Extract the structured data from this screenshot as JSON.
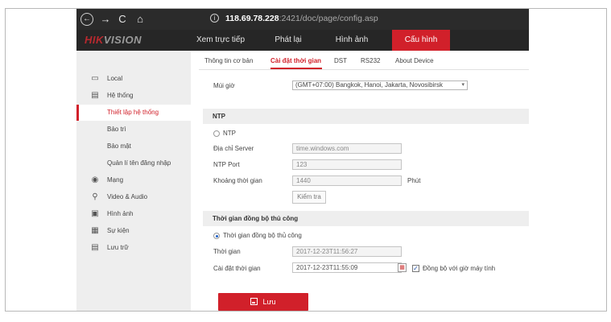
{
  "browser": {
    "back": "←",
    "forward": "→",
    "reload": "C",
    "home": "⌂",
    "info": "i",
    "url_host": "118.69.78.228",
    "url_path": ":2421/doc/page/config.asp"
  },
  "header": {
    "logo_main": "HIK",
    "logo_rest": "VISION",
    "menu": [
      "Xem trực tiếp",
      "Phát lại",
      "Hình ảnh",
      "Cấu hình"
    ]
  },
  "sidebar": {
    "items": [
      {
        "icon": "monitor-icon",
        "glyph": "▭",
        "label": "Local"
      },
      {
        "icon": "system-icon",
        "glyph": "▤",
        "label": "Hệ thống"
      },
      {
        "label": "Thiết lập hệ thống"
      },
      {
        "label": "Bảo trì"
      },
      {
        "label": "Bảo mật"
      },
      {
        "label": "Quản lí tên đăng nhập"
      },
      {
        "icon": "network-icon",
        "glyph": "◉",
        "label": "Mạng"
      },
      {
        "icon": "video-audio-icon",
        "glyph": "⚲",
        "label": "Video & Audio"
      },
      {
        "icon": "image-icon",
        "glyph": "▣",
        "label": "Hình ảnh"
      },
      {
        "icon": "event-icon",
        "glyph": "▦",
        "label": "Sự kiện"
      },
      {
        "icon": "storage-icon",
        "glyph": "▤",
        "label": "Lưu trữ"
      }
    ]
  },
  "tabs": [
    "Thông tin cơ bản",
    "Cài đặt thời gian",
    "DST",
    "RS232",
    "About Device"
  ],
  "form": {
    "timezone_label": "Múi giờ",
    "timezone_value": "(GMT+07:00) Bangkok, Hanoi, Jakarta, Novosibirsk",
    "timezone_arrow": "▾",
    "ntp_section": "NTP",
    "ntp_radio_label": "NTP",
    "server_label": "Địa chỉ Server",
    "server_value": "time.windows.com",
    "port_label": "NTP Port",
    "port_value": "123",
    "interval_label": "Khoảng thời gian",
    "interval_value": "1440",
    "interval_unit": "Phút",
    "test_button": "Kiểm tra",
    "manual_section": "Thời gian đồng bộ thủ công",
    "manual_radio_label": "Thời gian đồng bộ thủ công",
    "time_label": "Thời gian",
    "time_value": "2017-12-23T11:56:27",
    "set_time_label": "Cài đặt thời gian",
    "set_time_value": "2017-12-23T11:55:09",
    "calendar_glyph": "▦",
    "sync_check": "✓",
    "sync_label": "Đồng bộ với giờ máy tính",
    "save_label": "Lưu"
  },
  "colors": {
    "accent": "#d1202a",
    "header_bg": "#262626",
    "sidebar_bg": "#eeeeee"
  }
}
